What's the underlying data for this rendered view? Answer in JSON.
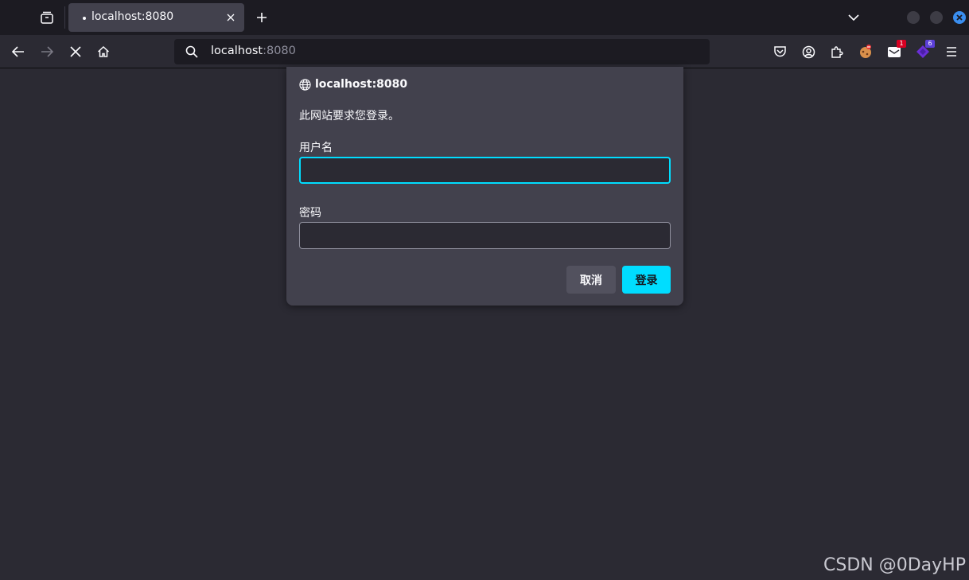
{
  "tabstrip": {
    "tab_title": "localhost:8080"
  },
  "urlbar": {
    "host": "localhost",
    "port": ":8080"
  },
  "toolbar": {
    "extension_badge_1": "1",
    "extension_badge_2": "6"
  },
  "dialog": {
    "host": "localhost:8080",
    "message": "此网站要求您登录。",
    "username_label": "用户名",
    "username_value": "",
    "password_label": "密码",
    "password_value": "",
    "cancel_label": "取消",
    "login_label": "登录"
  },
  "watermark": "CSDN @0DayHP",
  "colors": {
    "accent": "#00ddff",
    "background": "#2b2a33",
    "dialog": "#42414d"
  }
}
